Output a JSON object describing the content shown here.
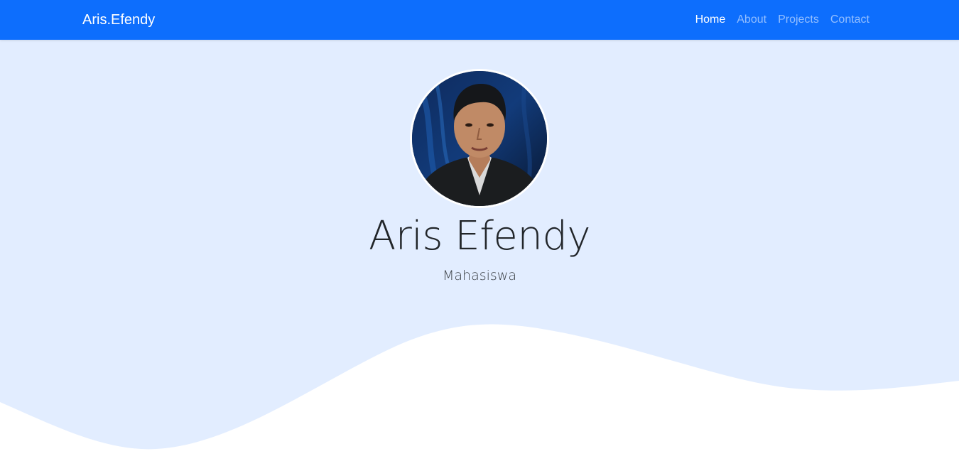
{
  "navbar": {
    "brand": "Aris.Efendy",
    "links": [
      {
        "label": "Home",
        "active": true
      },
      {
        "label": "About",
        "active": false
      },
      {
        "label": "Projects",
        "active": false
      },
      {
        "label": "Contact",
        "active": false
      }
    ]
  },
  "hero": {
    "name": "Aris Efendy",
    "role": "Mahasiswa"
  },
  "colors": {
    "navbar": "#0d6efd",
    "hero_background": "#e2edff",
    "wave": "#ffffff"
  }
}
